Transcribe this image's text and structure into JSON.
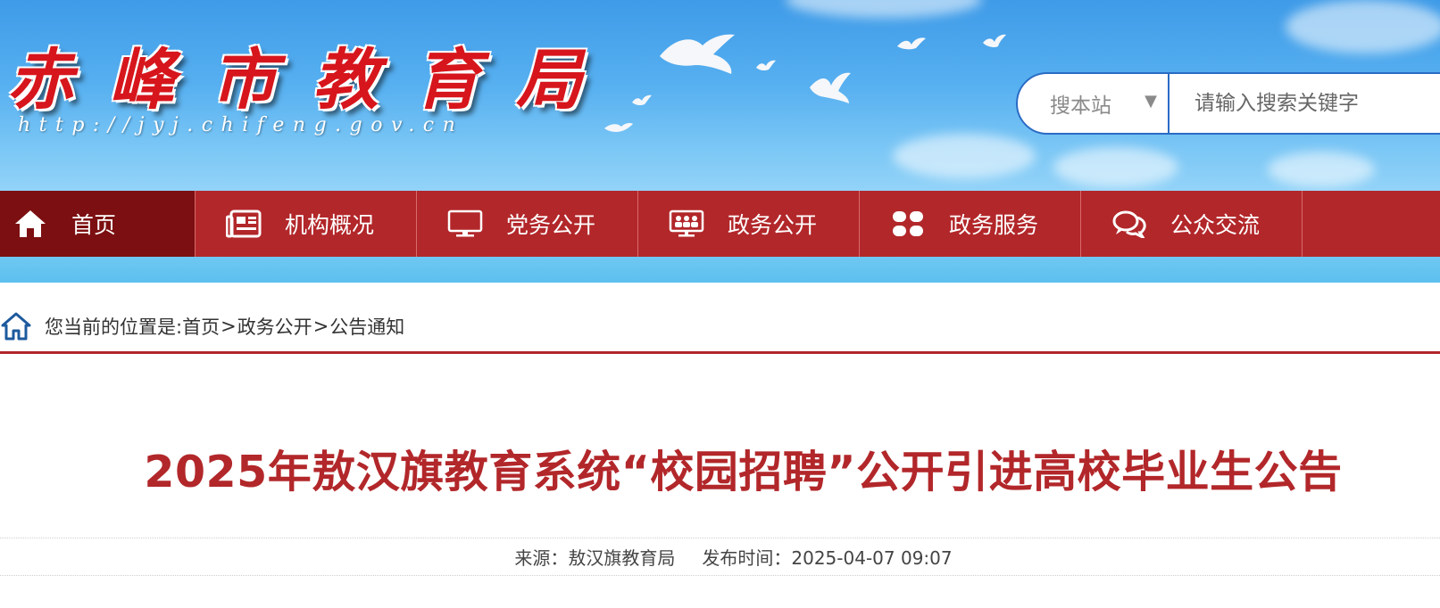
{
  "header": {
    "site_name": "赤峰市教育局",
    "site_url": "http://jyj.chifeng.gov.cn",
    "search": {
      "scope_label": "搜本站",
      "placeholder": "请输入搜索关键字"
    }
  },
  "nav": {
    "items": [
      {
        "label": "首页",
        "icon": "home-icon"
      },
      {
        "label": "机构概况",
        "icon": "newspaper-icon"
      },
      {
        "label": "党务公开",
        "icon": "monitor-icon"
      },
      {
        "label": "政务公开",
        "icon": "meeting-icon"
      },
      {
        "label": "政务服务",
        "icon": "grid-icon"
      },
      {
        "label": "公众交流",
        "icon": "chat-icon"
      }
    ]
  },
  "breadcrumb": {
    "prefix": "您当前的位置是:",
    "items": [
      "首页",
      "政务公开",
      "公告通知"
    ],
    "separator": ">"
  },
  "article": {
    "title": "2025年敖汉旗教育系统“校园招聘”公开引进高校毕业生公告",
    "source_label": "来源：",
    "source": "敖汉旗教育局",
    "date_label": "发布时间：",
    "date": "2025-04-07 09:07"
  },
  "colors": {
    "brand_red": "#b2272a",
    "nav_active": "#7c0f11",
    "search_border": "#2a6bc4"
  }
}
